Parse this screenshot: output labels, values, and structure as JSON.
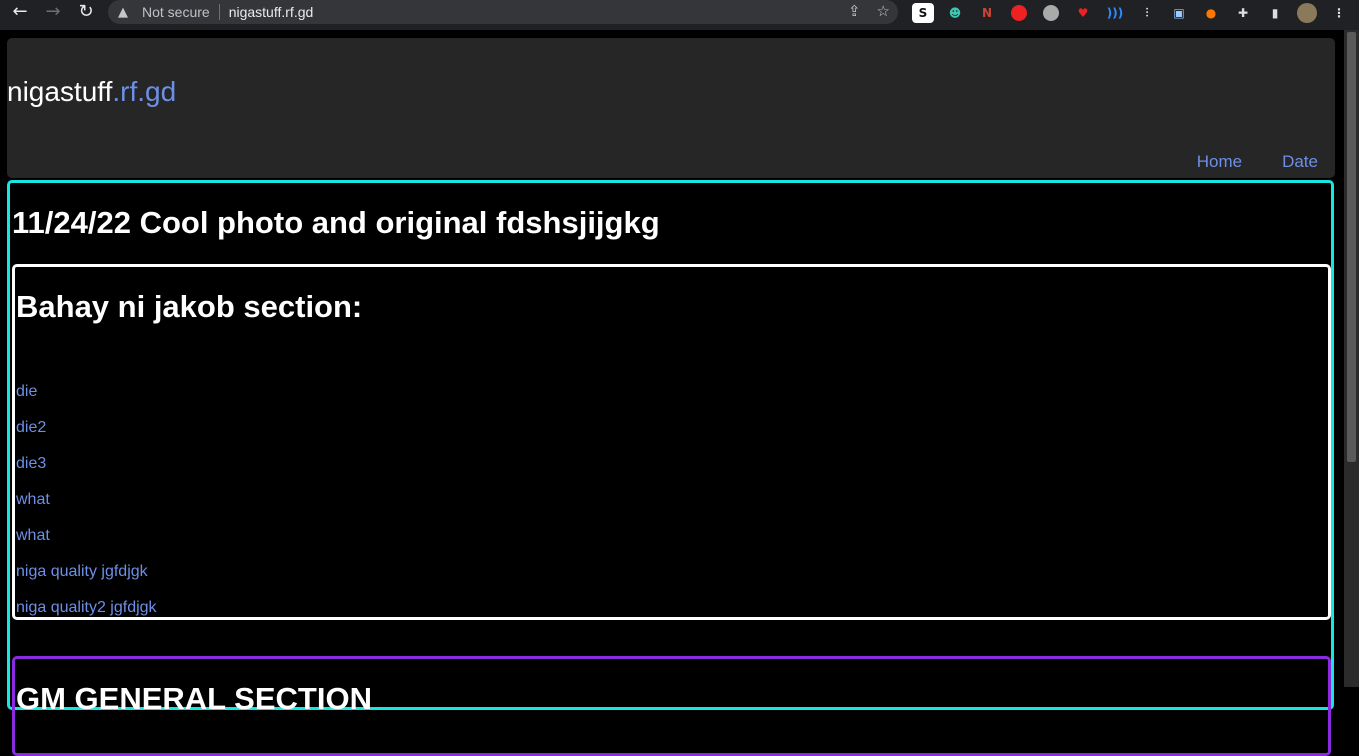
{
  "browser": {
    "security_label": "Not secure",
    "url": "nigastuff.rf.gd"
  },
  "site": {
    "logo_main": "nigastuff",
    "logo_tld": ".rf.gd",
    "nav": [
      "Home",
      "Date"
    ]
  },
  "post": {
    "title": "11/24/22 Cool photo and original fdshsjijgkg",
    "section_title": "Bahay ni jakob section:",
    "links": [
      "die",
      "die2",
      "die3",
      "what",
      "what",
      "niga quality jgfdjgk",
      "niga quality2 jgfdjgk"
    ],
    "next_section_title": "GM GENERAL SECTION"
  },
  "colors": {
    "accent_link": "#6d8fe6",
    "post_border": "#17e6e3",
    "section_border": "#ffffff",
    "next_section_border": "#8a2be2"
  }
}
